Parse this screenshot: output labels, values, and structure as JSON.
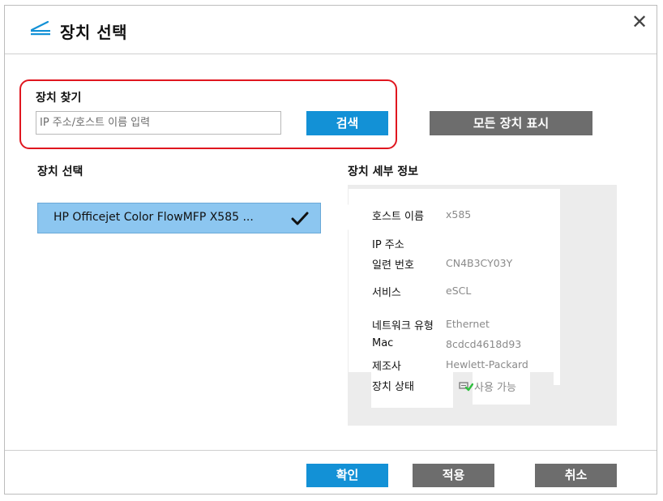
{
  "dialog": {
    "title": "장치 선택",
    "close_symbol": "✕",
    "icons": {
      "title": "scanner-icon",
      "close": "close-icon",
      "selected": "checkmark-icon",
      "status": "network-status-icon"
    },
    "colors": {
      "accent": "#1391d6",
      "selected": "#8cc6f0",
      "gray_button": "#6d6d6d",
      "highlight": "#e0161f",
      "status_ok": "#2fbf3f"
    }
  },
  "find": {
    "label": "장치 찾기",
    "input_placeholder": "IP 주소/호스트 이름 입력",
    "input_value": "",
    "search_button": "검색",
    "show_all_button": "모든 장치 표시"
  },
  "device_list": {
    "label": "장치 선택",
    "items": [
      {
        "name": "HP Officejet Color FlowMFP X585 ...",
        "selected": true
      }
    ]
  },
  "details": {
    "label": "장치 세부 정보",
    "rows": [
      {
        "label": "호스트 이름",
        "value": "x585"
      },
      {
        "label": "IP 주소",
        "value": ""
      },
      {
        "label": "일련 번호",
        "value": "CN4B3CY03Y"
      },
      {
        "label": "서비스",
        "value": "eSCL"
      },
      {
        "label": "네트워크 유형",
        "value": "Ethernet"
      },
      {
        "label": "Mac",
        "value": "8cdcd4618d93"
      },
      {
        "label": "제조사",
        "value": "Hewlett-Packard"
      },
      {
        "label": "장치 상태",
        "value": "사용 가능"
      }
    ]
  },
  "footer": {
    "ok_button": "확인",
    "apply_button": "적용",
    "cancel_button": "취소"
  }
}
